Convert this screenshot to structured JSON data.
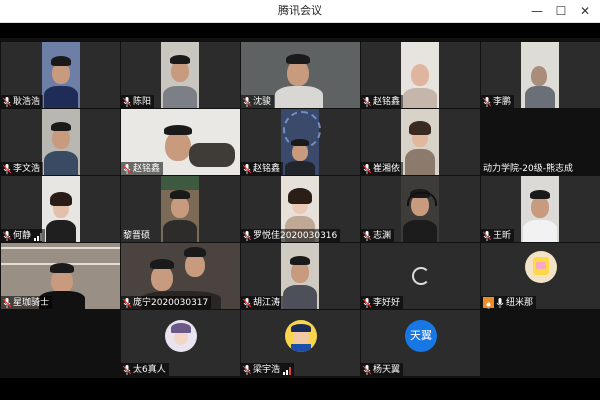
{
  "window": {
    "title": "腾讯会议",
    "minimize_glyph": "—",
    "maximize_glyph": "☐",
    "close_glyph": "✕"
  },
  "participants": [
    {
      "name": "耿浩浩",
      "bg": "#2c2c2c",
      "video": "#6d7fa6",
      "has_video": true
    },
    {
      "name": "陈阳",
      "bg": "#2c2c2c",
      "video": "#c9c6bf",
      "has_video": true
    },
    {
      "name": "沈骏",
      "bg": "#2c2c2c",
      "video": "#5f6263",
      "has_video": true
    },
    {
      "name": "赵铭鑫",
      "bg": "#2c2c2c",
      "video": "#e7e4df",
      "has_video": true
    },
    {
      "name": "李鹏",
      "bg": "#2c2c2c",
      "video": "#dedcd6",
      "has_video": true
    },
    {
      "name": "李文浩",
      "bg": "#2c2c2c",
      "video": "#b8b7b2",
      "has_video": true
    },
    {
      "name": "赵铭鑫",
      "bg": "#2c2c2c",
      "video": "#e9e8e4",
      "has_video": true
    },
    {
      "name": "赵铭鑫",
      "bg": "#2c2c2c",
      "video": "#3b4a6b",
      "has_video": true
    },
    {
      "name": "崔湘依",
      "bg": "#2c2c2c",
      "video": "#d9d2c8",
      "has_video": true
    },
    {
      "name": "动力学院-20级-熊志成",
      "bg": "#2c2c2c",
      "video": "#111111",
      "has_video": false
    },
    {
      "name": "何静",
      "bg": "#2c2c2c",
      "video": "#e8e6e3",
      "has_video": true
    },
    {
      "name": "黎晋硕",
      "bg": "#2c2c2c",
      "video": "#7b6a56",
      "has_video": true
    },
    {
      "name": "罗悦佳2020030316",
      "bg": "#2c2c2c",
      "video": "#e6e2da",
      "has_video": true
    },
    {
      "name": "志渊",
      "bg": "#2c2c2c",
      "video": "#3e3c38",
      "has_video": true
    },
    {
      "name": "王昕",
      "bg": "#2c2c2c",
      "video": "#dcdad6",
      "has_video": true
    },
    {
      "name": "星珈骑士",
      "bg": "#2c2c2c",
      "video": "#9a8f84",
      "has_video": true
    },
    {
      "name": "庞宁2020030317",
      "bg": "#2c2c2c",
      "video": "#4a4340",
      "has_video": true
    },
    {
      "name": "胡江涛",
      "bg": "#2c2c2c",
      "video": "#cfcac2",
      "has_video": true
    },
    {
      "name": "李好好",
      "bg": "#2c2c2c",
      "video": "#2c2c2c",
      "has_video": false
    },
    {
      "name": "纽米那",
      "bg": "#2c2c2c",
      "video": "#2c2c2c",
      "has_video": false
    },
    {
      "name": "太6真人",
      "bg": "#2c2c2c",
      "video": "#2c2c2c",
      "has_video": false
    },
    {
      "name": "梁宇浩",
      "bg": "#2c2c2c",
      "video": "#2c2c2c",
      "has_video": false
    },
    {
      "name": "杨天翼",
      "bg": "#2c2c2c",
      "video": "#2c2c2c",
      "has_video": false
    }
  ],
  "avatars": {
    "text_avatar_label": "天翼"
  }
}
